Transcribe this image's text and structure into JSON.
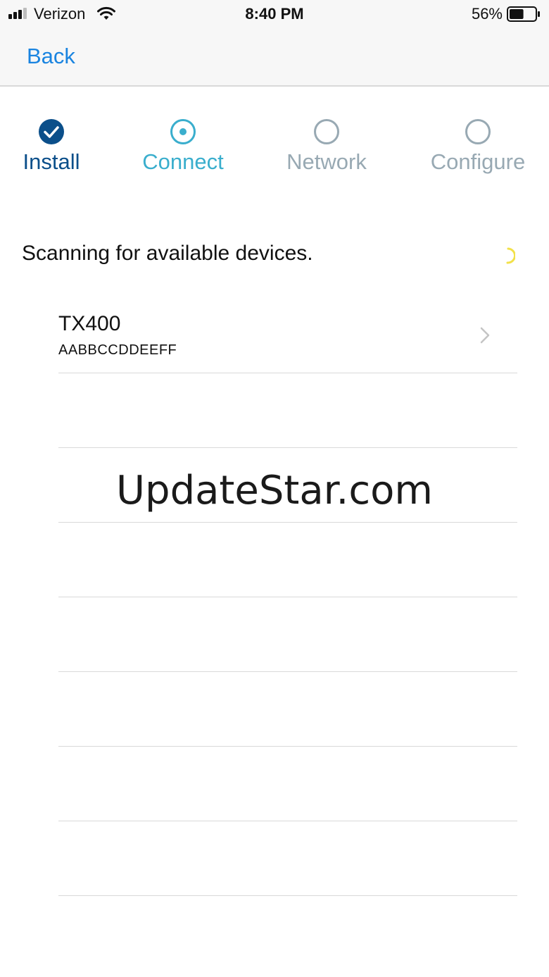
{
  "status_bar": {
    "carrier": "Verizon",
    "time": "8:40 PM",
    "battery_percent": "56%",
    "battery_level": 0.56,
    "signal_bars": 3,
    "signal_total": 4
  },
  "nav": {
    "back_label": "Back",
    "accent_color": "#1a84e0"
  },
  "stepper": {
    "steps": [
      {
        "label": "Install",
        "state": "complete",
        "icon": "check-circle-icon",
        "color": "#0b4f8a"
      },
      {
        "label": "Connect",
        "state": "current",
        "icon": "dot-circle-icon",
        "color": "#3aaecd"
      },
      {
        "label": "Network",
        "state": "pending",
        "icon": "empty-circle-icon",
        "color": "#98a9b3"
      },
      {
        "label": "Configure",
        "state": "pending",
        "icon": "empty-circle-icon",
        "color": "#98a9b3"
      }
    ]
  },
  "scan": {
    "message": "Scanning for available devices.",
    "spinner_icon": "loading-spinner-icon"
  },
  "devices": [
    {
      "name": "TX400",
      "id": "AABBCCDDEEFF",
      "icon": "chevron-right-icon"
    }
  ],
  "watermark": "UpdateStar.com"
}
